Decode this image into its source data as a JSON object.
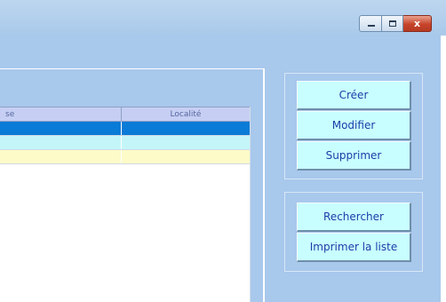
{
  "window": {
    "controls": {
      "minimize_icon": "minimize-icon",
      "maximize_icon": "maximize-icon",
      "close_icon": "close-icon",
      "close_glyph": "x"
    }
  },
  "grid": {
    "columns": [
      "se",
      "Localité"
    ],
    "rows": [
      {
        "state": "selected",
        "cells": [
          "",
          ""
        ]
      },
      {
        "state": "normal",
        "cells": [
          "",
          ""
        ]
      },
      {
        "state": "alternate",
        "cells": [
          "",
          ""
        ]
      }
    ]
  },
  "actions": {
    "create_label": "Créer",
    "edit_label": "Modifier",
    "delete_label": "Supprimer",
    "search_label": "Rechercher",
    "print_label": "Imprimer la liste"
  },
  "colors": {
    "window_background": "#a8c8ec",
    "button_background": "#c8feff",
    "button_text": "#1b3ea8",
    "grid_header": "#c6cff3",
    "row_selected": "#0a7bd6",
    "row_cyan": "#c4f6f9",
    "row_yellow": "#fdfbc8",
    "close_button": "#c6432a"
  }
}
